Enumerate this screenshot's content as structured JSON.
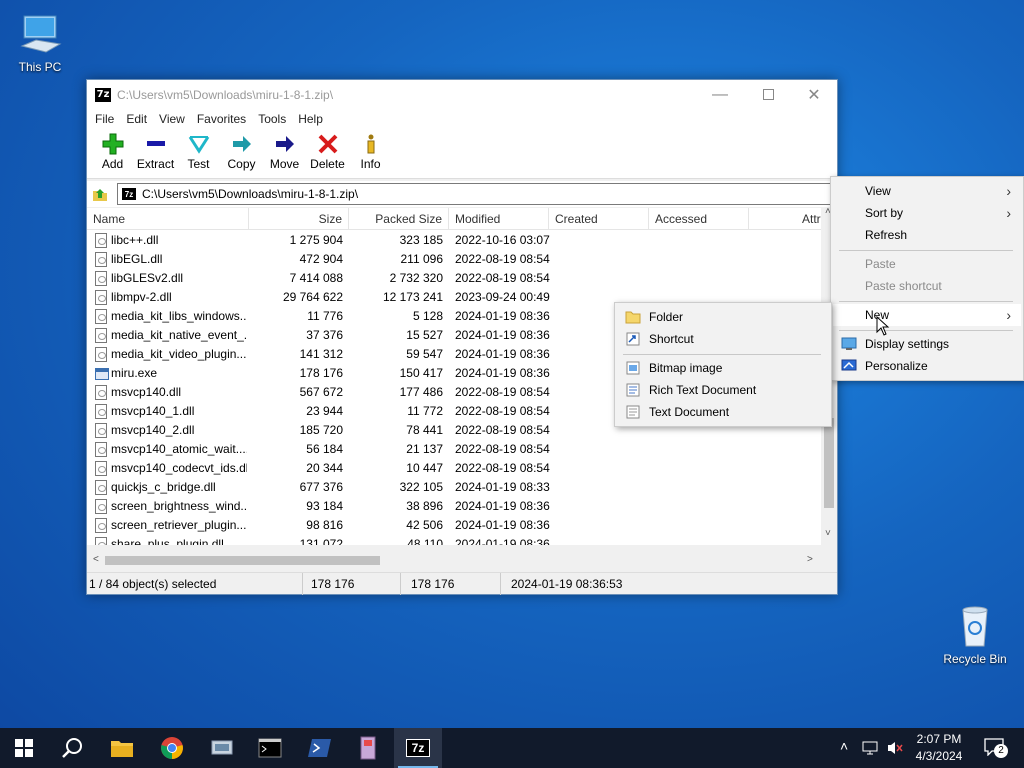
{
  "desktop": {
    "icons": [
      {
        "label": "This PC"
      },
      {
        "label": "Recycle Bin"
      }
    ]
  },
  "window": {
    "title": "C:\\Users\\vm5\\Downloads\\miru-1-8-1.zip\\",
    "app_icon_text": "7z",
    "menu": [
      "File",
      "Edit",
      "View",
      "Favorites",
      "Tools",
      "Help"
    ],
    "toolbar": [
      "Add",
      "Extract",
      "Test",
      "Copy",
      "Move",
      "Delete",
      "Info"
    ],
    "address": "C:\\Users\\vm5\\Downloads\\miru-1-8-1.zip\\",
    "columns": [
      "Name",
      "Size",
      "Packed Size",
      "Modified",
      "Created",
      "Accessed",
      "Attrib"
    ],
    "files": [
      {
        "name": "libc++.dll",
        "size": "1 275 904",
        "packed": "323 185",
        "modified": "2022-10-16 03:07",
        "type": "dll"
      },
      {
        "name": "libEGL.dll",
        "size": "472 904",
        "packed": "211 096",
        "modified": "2022-08-19 08:54",
        "type": "dll"
      },
      {
        "name": "libGLESv2.dll",
        "size": "7 414 088",
        "packed": "2 732 320",
        "modified": "2022-08-19 08:54",
        "type": "dll"
      },
      {
        "name": "libmpv-2.dll",
        "size": "29 764 622",
        "packed": "12 173 241",
        "modified": "2023-09-24 00:49",
        "type": "dll"
      },
      {
        "name": "media_kit_libs_windows...",
        "size": "11 776",
        "packed": "5 128",
        "modified": "2024-01-19 08:36",
        "type": "dll"
      },
      {
        "name": "media_kit_native_event_...",
        "size": "37 376",
        "packed": "15 527",
        "modified": "2024-01-19 08:36",
        "type": "dll"
      },
      {
        "name": "media_kit_video_plugin....",
        "size": "141 312",
        "packed": "59 547",
        "modified": "2024-01-19 08:36",
        "type": "dll"
      },
      {
        "name": "miru.exe",
        "size": "178 176",
        "packed": "150 417",
        "modified": "2024-01-19 08:36",
        "type": "exe"
      },
      {
        "name": "msvcp140.dll",
        "size": "567 672",
        "packed": "177 486",
        "modified": "2022-08-19 08:54",
        "type": "dll"
      },
      {
        "name": "msvcp140_1.dll",
        "size": "23 944",
        "packed": "11 772",
        "modified": "2022-08-19 08:54",
        "type": "dll"
      },
      {
        "name": "msvcp140_2.dll",
        "size": "185 720",
        "packed": "78 441",
        "modified": "2022-08-19 08:54",
        "type": "dll"
      },
      {
        "name": "msvcp140_atomic_wait....",
        "size": "56 184",
        "packed": "21 137",
        "modified": "2022-08-19 08:54",
        "type": "dll"
      },
      {
        "name": "msvcp140_codecvt_ids.dll",
        "size": "20 344",
        "packed": "10 447",
        "modified": "2022-08-19 08:54",
        "type": "dll"
      },
      {
        "name": "quickjs_c_bridge.dll",
        "size": "677 376",
        "packed": "322 105",
        "modified": "2024-01-19 08:33",
        "type": "dll"
      },
      {
        "name": "screen_brightness_wind...",
        "size": "93 184",
        "packed": "38 896",
        "modified": "2024-01-19 08:36",
        "type": "dll"
      },
      {
        "name": "screen_retriever_plugin....",
        "size": "98 816",
        "packed": "42 506",
        "modified": "2024-01-19 08:36",
        "type": "dll"
      },
      {
        "name": "share_plus_plugin.dll",
        "size": "131 072",
        "packed": "48 110",
        "modified": "2024-01-19 08:36",
        "type": "dll"
      }
    ],
    "status": {
      "selected": "1 / 84 object(s) selected",
      "size": "178 176",
      "packed": "178 176",
      "modified": "2024-01-19 08:36:53"
    }
  },
  "context_menu": {
    "items": [
      {
        "label": "View",
        "submenu": true,
        "disabled": false
      },
      {
        "label": "Sort by",
        "submenu": true,
        "disabled": false
      },
      {
        "label": "Refresh",
        "submenu": false,
        "disabled": false
      },
      {
        "label": "Paste",
        "submenu": false,
        "disabled": true
      },
      {
        "label": "Paste shortcut",
        "submenu": false,
        "disabled": true
      },
      {
        "label": "New",
        "submenu": true,
        "disabled": false,
        "highlighted": true
      },
      {
        "label": "Display settings",
        "submenu": false,
        "disabled": false,
        "icon": "display-icon"
      },
      {
        "label": "Personalize",
        "submenu": false,
        "disabled": false,
        "icon": "personalize-icon"
      }
    ]
  },
  "new_submenu": {
    "items": [
      {
        "label": "Folder",
        "icon": "folder-icon"
      },
      {
        "label": "Shortcut",
        "icon": "shortcut-icon"
      },
      {
        "label": "Bitmap image",
        "icon": "bitmap-icon"
      },
      {
        "label": "Rich Text Document",
        "icon": "rtf-icon"
      },
      {
        "label": "Text Document",
        "icon": "text-document-icon"
      }
    ]
  },
  "taskbar": {
    "apps": [
      "start-icon",
      "search-icon",
      "file-explorer-icon",
      "chrome-icon",
      "network-app-icon",
      "cmd-icon",
      "powershell-icon",
      "archive-app-icon",
      "7zip-icon"
    ],
    "tray": {
      "time": "2:07 PM",
      "date": "4/3/2024",
      "notifications": "2"
    }
  },
  "colors": {
    "accent": "#0078d7",
    "taskbar": "#111a2b",
    "selection": "#cce8ff"
  }
}
